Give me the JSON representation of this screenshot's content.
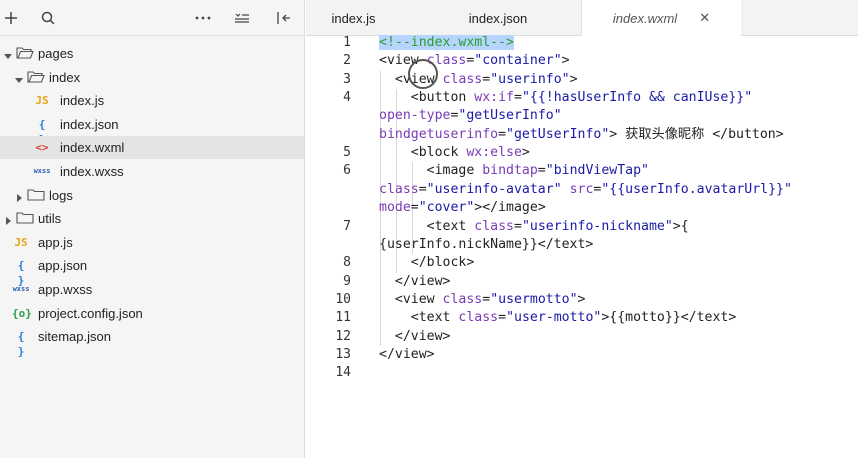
{
  "toolbar": {
    "icons": [
      "add-icon",
      "search-icon",
      "more-icon",
      "collapse-icon",
      "split-icon"
    ]
  },
  "tree": [
    {
      "label": "pages",
      "type": "folder",
      "expanded": true,
      "depth": 0
    },
    {
      "label": "index",
      "type": "folder",
      "expanded": true,
      "depth": 1
    },
    {
      "label": "index.js",
      "type": "js",
      "icon_text": "JS",
      "depth": 2
    },
    {
      "label": "index.json",
      "type": "json",
      "icon_text": "{ }",
      "depth": 2
    },
    {
      "label": "index.wxml",
      "type": "wxml",
      "icon_text": "<>",
      "depth": 2,
      "selected": true
    },
    {
      "label": "index.wxss",
      "type": "wxss",
      "icon_text": "wxss",
      "depth": 2
    },
    {
      "label": "logs",
      "type": "folder",
      "expanded": false,
      "depth": 1
    },
    {
      "label": "utils",
      "type": "folder",
      "expanded": false,
      "depth": 0
    },
    {
      "label": "app.js",
      "type": "js",
      "icon_text": "JS",
      "depth": 0
    },
    {
      "label": "app.json",
      "type": "json",
      "icon_text": "{ }",
      "depth": 0
    },
    {
      "label": "app.wxss",
      "type": "wxss",
      "icon_text": "wxss",
      "depth": 0
    },
    {
      "label": "project.config.json",
      "type": "config",
      "icon_text": "{o}",
      "depth": 0
    },
    {
      "label": "sitemap.json",
      "type": "json",
      "icon_text": "{ }",
      "depth": 0
    }
  ],
  "tabs": [
    {
      "label": "index.js",
      "active": false
    },
    {
      "label": "index.json",
      "active": false
    },
    {
      "label": "index.wxml",
      "active": true,
      "close": "✕"
    }
  ],
  "colors": {
    "js": "#e8a317",
    "json": "#2b7bd6",
    "wxml": "#e0443a",
    "wxss": "#2b5fb8",
    "config": "#2e9c4a",
    "selection": "#b5d5ff",
    "comment": "#2a9d2a",
    "attribute": "#7a3bb6",
    "string": "#1a1aa6"
  },
  "editor": {
    "line_numbers": [
      "1",
      "2",
      "3",
      "4",
      "",
      "",
      "5",
      "6",
      "",
      "",
      "7",
      "",
      "8",
      "9",
      "10",
      "11",
      "12",
      "13",
      "14"
    ],
    "lines": [
      [
        {
          "t": "<!--index.wxml-->",
          "c": "cmt",
          "hl": true
        }
      ],
      [
        {
          "t": "<view ",
          "c": "tag"
        },
        {
          "t": "class",
          "c": "attr"
        },
        {
          "t": "=",
          "c": "tag"
        },
        {
          "t": "\"container\"",
          "c": "str"
        },
        {
          "t": ">",
          "c": "tag"
        }
      ],
      [
        {
          "t": "  <view ",
          "c": "tag"
        },
        {
          "t": "class",
          "c": "attr"
        },
        {
          "t": "=",
          "c": "tag"
        },
        {
          "t": "\"userinfo\"",
          "c": "str"
        },
        {
          "t": ">",
          "c": "tag"
        }
      ],
      [
        {
          "t": "    <button ",
          "c": "tag"
        },
        {
          "t": "wx:if",
          "c": "attr"
        },
        {
          "t": "=",
          "c": "tag"
        },
        {
          "t": "\"{{!hasUserInfo && canIUse}}\"",
          "c": "str"
        }
      ],
      [
        {
          "t": "open-type",
          "c": "attr"
        },
        {
          "t": "=",
          "c": "tag"
        },
        {
          "t": "\"getUserInfo\"",
          "c": "str"
        }
      ],
      [
        {
          "t": "bindgetuserinfo",
          "c": "attr"
        },
        {
          "t": "=",
          "c": "tag"
        },
        {
          "t": "\"getUserInfo\"",
          "c": "str"
        },
        {
          "t": "> 获取头像昵称 </button>",
          "c": "tag"
        }
      ],
      [
        {
          "t": "    <block ",
          "c": "tag"
        },
        {
          "t": "wx:else",
          "c": "attr"
        },
        {
          "t": ">",
          "c": "tag"
        }
      ],
      [
        {
          "t": "      <image ",
          "c": "tag"
        },
        {
          "t": "bindtap",
          "c": "attr"
        },
        {
          "t": "=",
          "c": "tag"
        },
        {
          "t": "\"bindViewTap\"",
          "c": "str"
        }
      ],
      [
        {
          "t": "class",
          "c": "attr"
        },
        {
          "t": "=",
          "c": "tag"
        },
        {
          "t": "\"userinfo-avatar\" ",
          "c": "str"
        },
        {
          "t": "src",
          "c": "attr"
        },
        {
          "t": "=",
          "c": "tag"
        },
        {
          "t": "\"{{userInfo.avatarUrl}}\"",
          "c": "str"
        }
      ],
      [
        {
          "t": "mode",
          "c": "attr"
        },
        {
          "t": "=",
          "c": "tag"
        },
        {
          "t": "\"cover\"",
          "c": "str"
        },
        {
          "t": "></image>",
          "c": "tag"
        }
      ],
      [
        {
          "t": "      <text ",
          "c": "tag"
        },
        {
          "t": "class",
          "c": "attr"
        },
        {
          "t": "=",
          "c": "tag"
        },
        {
          "t": "\"userinfo-nickname\"",
          "c": "str"
        },
        {
          "t": ">{",
          "c": "tag"
        }
      ],
      [
        {
          "t": "{userInfo.nickName}}</text>",
          "c": "tag"
        }
      ],
      [
        {
          "t": "    </block>",
          "c": "tag"
        }
      ],
      [
        {
          "t": "  </view>",
          "c": "tag"
        }
      ],
      [
        {
          "t": "  <view ",
          "c": "tag"
        },
        {
          "t": "class",
          "c": "attr"
        },
        {
          "t": "=",
          "c": "tag"
        },
        {
          "t": "\"usermotto\"",
          "c": "str"
        },
        {
          "t": ">",
          "c": "tag"
        }
      ],
      [
        {
          "t": "    <text ",
          "c": "tag"
        },
        {
          "t": "class",
          "c": "attr"
        },
        {
          "t": "=",
          "c": "tag"
        },
        {
          "t": "\"user-motto\"",
          "c": "str"
        },
        {
          "t": ">{{motto}}</text>",
          "c": "tag"
        }
      ],
      [
        {
          "t": "  </view>",
          "c": "tag"
        }
      ],
      [
        {
          "t": "</view>",
          "c": "tag"
        }
      ],
      [
        {
          "t": "",
          "c": "tag"
        }
      ]
    ]
  }
}
